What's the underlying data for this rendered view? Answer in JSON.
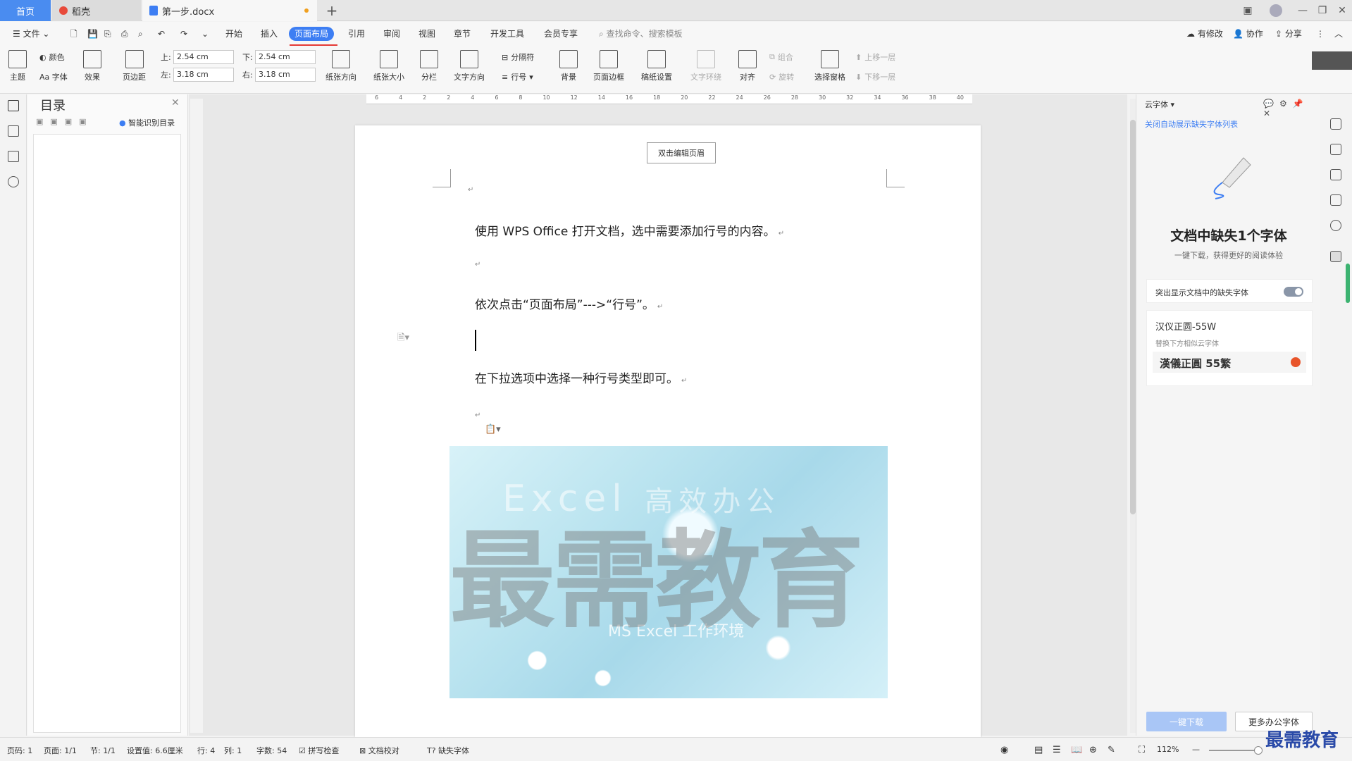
{
  "titlebar": {
    "tabs": [
      "首页",
      "稻壳",
      "第一步.docx"
    ],
    "add_label": "+"
  },
  "menubar": {
    "file_label": "文件",
    "items": [
      "开始",
      "插入",
      "页面布局",
      "引用",
      "审阅",
      "视图",
      "章节",
      "开发工具",
      "会员专享"
    ],
    "search_placeholder": "查找命令、搜索模板",
    "right_items": [
      "有修改",
      "协作",
      "分享"
    ]
  },
  "ribbon": {
    "theme": "主题",
    "color": "颜色",
    "font": "Aa 字体",
    "effect": "效果",
    "margins": "页边距",
    "margin_top_label": "上:",
    "margin_top_value": "2.54 cm",
    "margin_bottom_label": "下:",
    "margin_bottom_value": "2.54 cm",
    "margin_left_label": "左:",
    "margin_left_value": "3.18 cm",
    "margin_right_label": "右:",
    "margin_right_value": "3.18 cm",
    "orientation": "纸张方向",
    "size": "纸张大小",
    "columns": "分栏",
    "text_direction": "文字方向",
    "separator": "分隔符",
    "line_number": "行号",
    "background": "背景",
    "page_border": "页面边框",
    "draft_setting": "稿纸设置",
    "text_wrap": "文字环绕",
    "align": "对齐",
    "group": "组合",
    "rotate": "旋转",
    "select_pane": "选择窗格",
    "bring_forward": "上移一层",
    "send_backward": "下移一层"
  },
  "toc": {
    "title": "目录",
    "smart_label": "智能识别目录"
  },
  "document": {
    "header_hint": "双击编辑页眉",
    "paragraphs": [
      "使用 WPS Office 打开文档，选中需要添加行号的内容。",
      "依次点击“页面布局”--->“行号”。",
      "在下拉选项中选择一种行号类型即可。"
    ],
    "banner_english": "Excel",
    "banner_cn": "高效办公",
    "banner_sub": "MS Excel 工作环境",
    "watermark": "最需教育",
    "ruler_numbers": [
      "6",
      "4",
      "2",
      "2",
      "4",
      "6",
      "8",
      "10",
      "12",
      "14",
      "16",
      "18",
      "20",
      "22",
      "24",
      "26",
      "28",
      "30",
      "32",
      "34",
      "36",
      "38",
      "40"
    ]
  },
  "right_panel": {
    "title": "云字体",
    "link": "关闭自动展示缺失字体列表",
    "headline": "文档中缺失1个字体",
    "sub": "一键下载，获得更好的阅读体验",
    "toggle_label": "突出显示文档中的缺失字体",
    "font_name": "汉仪正圆-55W",
    "font_hint": "替换下方相似云字体",
    "font_sample": "漢儀正圓 55繁",
    "download_btn": "一键下载",
    "more_btn": "更多办公字体"
  },
  "statusbar": {
    "page_code": "页码: 1",
    "page": "页面: 1/1",
    "section": "节: 1/1",
    "setting": "设置值: 6.6厘米",
    "row": "行: 4",
    "col": "列: 1",
    "words": "字数: 54",
    "spell": "拼写检查",
    "proof": "文档校对",
    "missing_font": "缺失字体",
    "zoom": "112%"
  },
  "corner_logo": "最需教育"
}
